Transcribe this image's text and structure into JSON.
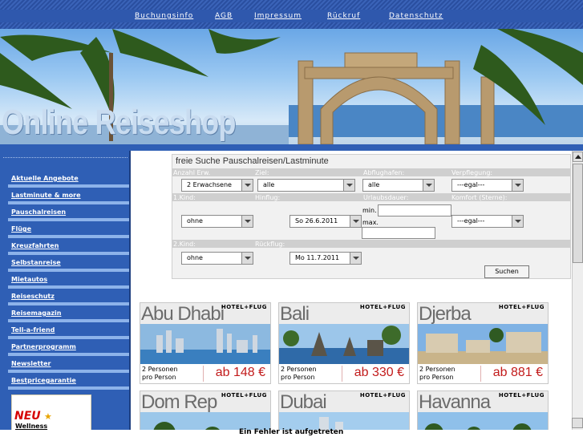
{
  "topnav": {
    "links": [
      "Buchungsinfo",
      "AGB",
      "Impressum",
      "Rückruf",
      "Datenschutz"
    ]
  },
  "banner": {
    "title": "Online Reiseshop"
  },
  "sidebar": {
    "items": [
      "Aktuelle Angebote",
      "Lastminute & more",
      "Pauschalreisen",
      "Flüge",
      "Kreuzfahrten",
      "Selbstanreise",
      "Mietautos",
      "Reiseschutz",
      "Reisemagazin",
      "Tell-a-friend",
      "Partnerprogramm",
      "Newsletter",
      "Bestpricegarantie"
    ],
    "promo": {
      "new": "NEU",
      "label": "Wellness"
    }
  },
  "search": {
    "title": "freie Suche Pauschalreisen/Lastminute",
    "labels": {
      "adults": "Anzahl Erw.",
      "goal": "Ziel:",
      "airports": "Abflughafen:",
      "board": "Verpflegung:",
      "child1": "1.Kind:",
      "outbound": "Hinflug:",
      "duration": "Urlaubsdauer:",
      "comfort": "Komfort (Sterne):",
      "child2": "2.Kind:",
      "return": "Rückflug:",
      "min": "min.",
      "max": "max."
    },
    "values": {
      "adults": "2 Erwachsene",
      "goal": "alle",
      "airports": "alle",
      "board": "---egal---",
      "child1": "ohne",
      "outbound": "So 26.6.2011",
      "comfort": "---egal---",
      "child2": "ohne",
      "return": "Mo 11.7.2011"
    },
    "submit": "Suchen"
  },
  "offers": {
    "badge": "HOTEL+FLUG",
    "tiles": [
      {
        "city": "Abu Dhabi",
        "persons": "2 Personen",
        "per": "pro Person",
        "price": "ab 148 €"
      },
      {
        "city": "Bali",
        "persons": "2 Personen",
        "per": "pro Person",
        "price": "ab 330 €"
      },
      {
        "city": "Djerba",
        "persons": "2 Personen",
        "per": "pro Person",
        "price": "ab 881 €"
      },
      {
        "city": "Dom Rep"
      },
      {
        "city": "Dubai"
      },
      {
        "city": "Havanna"
      }
    ]
  },
  "status": {
    "error": "Ein Fehler ist aufgetreten"
  }
}
